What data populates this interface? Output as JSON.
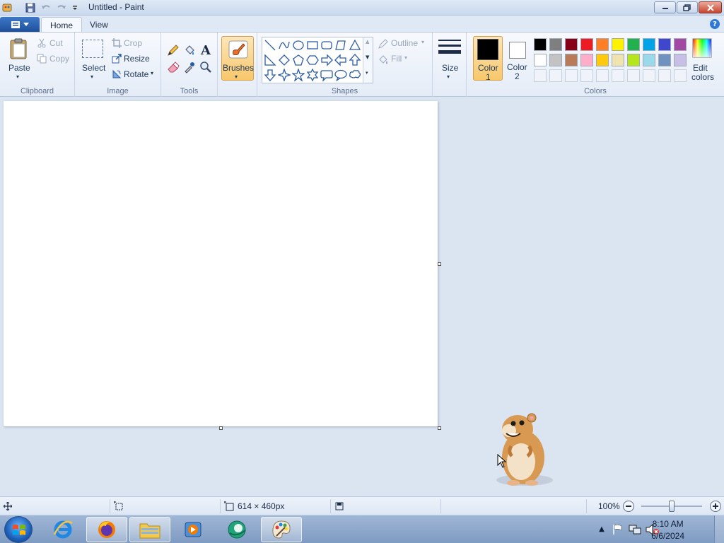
{
  "window": {
    "title": "Untitled - Paint"
  },
  "tabs": [
    {
      "label": "Home"
    },
    {
      "label": "View"
    }
  ],
  "ribbon": {
    "clipboard": {
      "label": "Clipboard",
      "paste": "Paste",
      "cut": "Cut",
      "copy": "Copy"
    },
    "image": {
      "label": "Image",
      "select": "Select",
      "crop": "Crop",
      "resize": "Resize",
      "rotate": "Rotate"
    },
    "tools": {
      "label": "Tools"
    },
    "brushes": {
      "label": "Brushes"
    },
    "shapes": {
      "label": "Shapes",
      "outline": "Outline",
      "fill": "Fill"
    },
    "size": {
      "label": "Size"
    },
    "colors": {
      "label": "Colors",
      "color1": "Color",
      "color1_num": "1",
      "color2": "Color",
      "color2_num": "2",
      "edit": "Edit",
      "edit2": "colors",
      "color1_value": "#000000",
      "color2_value": "#ffffff",
      "palette_row1": [
        "#000000",
        "#7f7f7f",
        "#880015",
        "#ed1c24",
        "#ff7f27",
        "#fff200",
        "#22b14c",
        "#00a2e8",
        "#3f48cc",
        "#a349a4"
      ],
      "palette_row2": [
        "#ffffff",
        "#c3c3c3",
        "#b97a57",
        "#ffaec9",
        "#ffc90e",
        "#efe4b0",
        "#b5e61d",
        "#99d9ea",
        "#7092be",
        "#c8bfe7"
      ]
    }
  },
  "status": {
    "dimensions": "614 × 460px",
    "zoom": "100%"
  },
  "taskbar": {
    "time": "8:10 AM",
    "date": "6/6/2024"
  }
}
